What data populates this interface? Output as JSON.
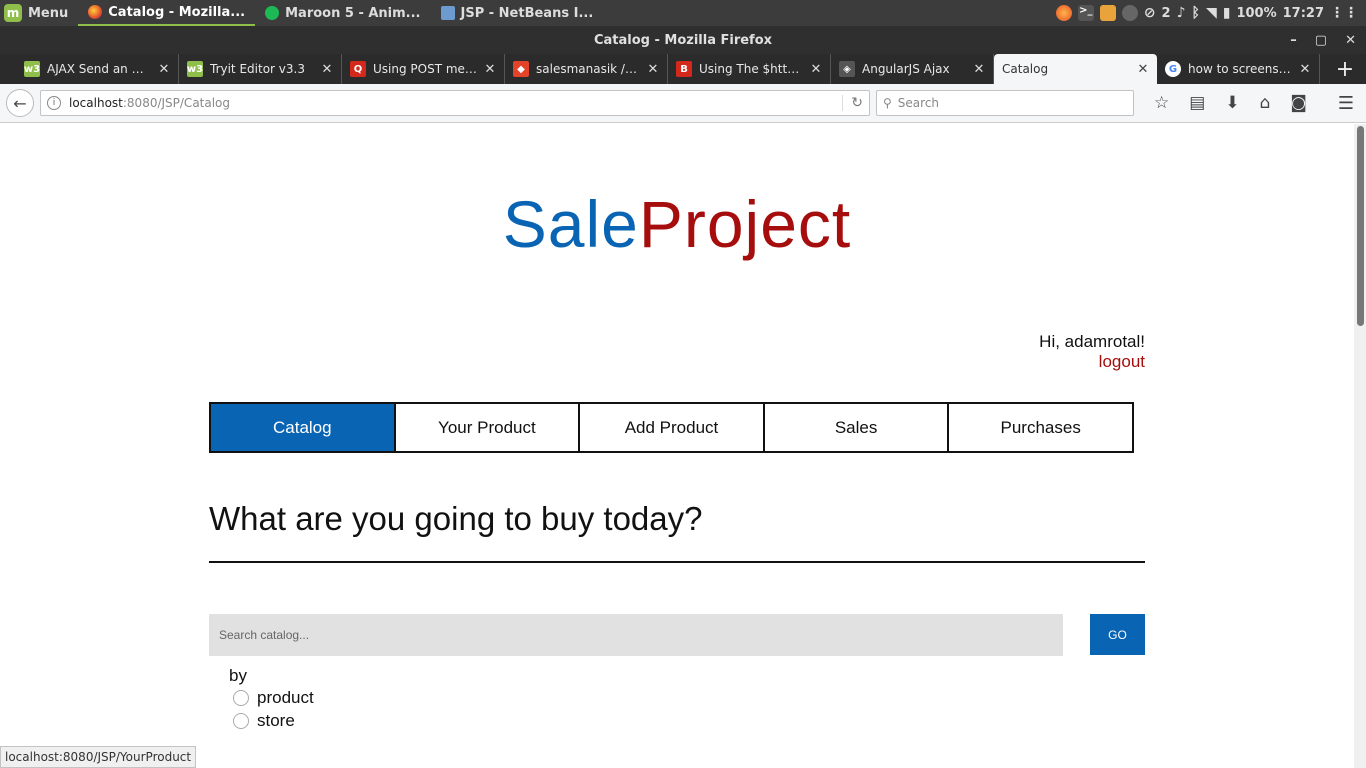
{
  "os_panel": {
    "menu_label": "Menu",
    "tasks": [
      {
        "label": "Catalog - Mozilla...",
        "icon": "firefox-icon",
        "active": true
      },
      {
        "label": "Maroon 5 - Anim...",
        "icon": "spotify-icon",
        "active": false
      },
      {
        "label": "JSP - NetBeans I...",
        "icon": "netbeans-icon",
        "active": false
      }
    ],
    "tray": {
      "notification_count": "2",
      "battery": "100%",
      "clock": "17:27"
    }
  },
  "window": {
    "title": "Catalog - Mozilla Firefox",
    "controls": [
      "–",
      "▢",
      "✕"
    ]
  },
  "tabs": [
    {
      "label": "AJAX Send an X...",
      "favicon_color": "#8fbf4a",
      "favicon_text": "w3"
    },
    {
      "label": "Tryit Editor v3.3",
      "favicon_color": "#8fbf4a",
      "favicon_text": "w3"
    },
    {
      "label": "Using POST met...",
      "favicon_color": "#d4281c",
      "favicon_text": "Q"
    },
    {
      "label": "salesmanasik / T...",
      "favicon_color": "#e24329",
      "favicon_text": "◆"
    },
    {
      "label": "Using The $http ...",
      "favicon_color": "#d4281c",
      "favicon_text": "B"
    },
    {
      "label": "AngularJS Ajax",
      "favicon_color": "#555555",
      "favicon_text": "◈"
    },
    {
      "label": "Catalog",
      "favicon_color": "",
      "favicon_text": "",
      "selected": true
    },
    {
      "label": "how to screensh...",
      "favicon_color": "#4285f4",
      "favicon_text": "G"
    }
  ],
  "navbar": {
    "url_host": "localhost",
    "url_rest": ":8080/JSP/Catalog",
    "search_placeholder": "Search"
  },
  "page": {
    "logo_part1": "Sale",
    "logo_part2": "Project",
    "greeting": "Hi, adamrotal!",
    "logout": "logout",
    "nav": [
      "Catalog",
      "Your Product",
      "Add Product",
      "Sales",
      "Purchases"
    ],
    "active_nav": "Catalog",
    "heading": "What are you going to buy today?",
    "search_placeholder": "Search catalog...",
    "go_label": "GO",
    "by_label": "by",
    "radio_options": [
      "product",
      "store"
    ]
  },
  "status_bar": {
    "url": "localhost:8080/JSP/YourProduct"
  },
  "colors": {
    "brand_blue": "#0a64b4",
    "brand_red": "#a60d0d"
  }
}
